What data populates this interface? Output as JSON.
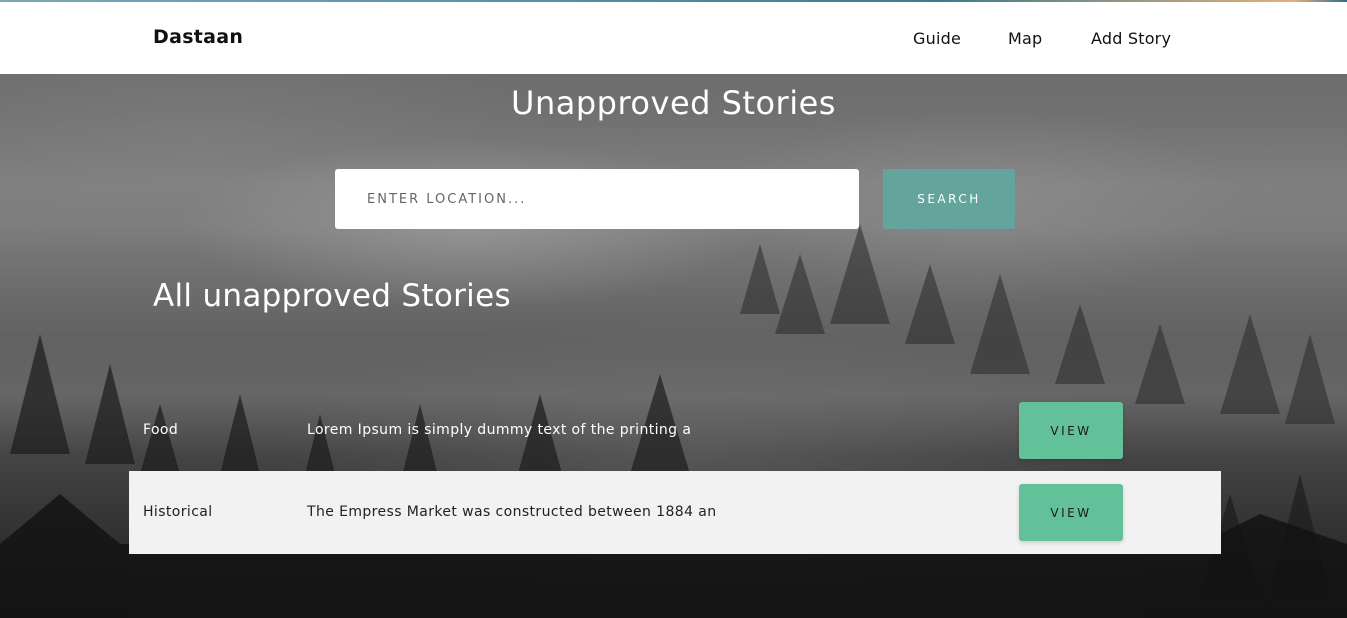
{
  "navbar": {
    "brand": "Dastaan",
    "links": [
      "Guide",
      "Map",
      "Add Story"
    ]
  },
  "hero": {
    "title": "Unapproved Stories"
  },
  "search": {
    "placeholder": "ENTER LOCATION...",
    "button_label": "SEARCH"
  },
  "section": {
    "heading": "All unapproved Stories"
  },
  "stories": [
    {
      "category": "Food",
      "text": "Lorem Ipsum is simply dummy text of the printing a",
      "button_label": "VIEW"
    },
    {
      "category": "Historical",
      "text": "The Empress Market was constructed between 1884 an",
      "button_label": "VIEW"
    }
  ],
  "colors": {
    "search_button": "#63a49d",
    "view_button": "#62c199",
    "highlight_row": "#f2f2f2",
    "navbar_bg": "#ffffff"
  }
}
